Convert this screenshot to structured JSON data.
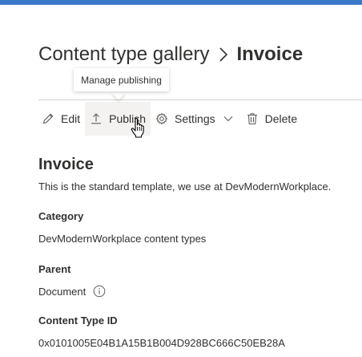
{
  "breadcrumb": {
    "parent": "Content type gallery",
    "current": "Invoice"
  },
  "tooltip": {
    "text": "Manage publishing"
  },
  "commands": {
    "edit": "Edit",
    "publish": "Publish",
    "settings": "Settings",
    "delete": "Delete"
  },
  "detail": {
    "title": "Invoice",
    "description": "This is the standard template, we use at DevModernWorkplace.",
    "category_label": "Category",
    "category_value": "DevModernWorkplace content types",
    "parent_label": "Parent",
    "parent_value": "Document",
    "id_label": "Content Type ID",
    "id_value": "0x0101005E04B1A15B1B004D928BC666C50EB28A"
  },
  "icons": {
    "edit": "pencil-icon",
    "publish": "upload-icon",
    "settings": "gear-icon",
    "settings_menu": "chevron-down-icon",
    "delete": "trash-icon",
    "breadcrumb_separator": "chevron-right-icon",
    "parent_info": "info-icon",
    "pointer": "hand-cursor-icon"
  },
  "colors": {
    "top_bar": "#3a77c7",
    "text": "#323130",
    "hover_background": "#f3f2f1",
    "icon": "#605e5c"
  }
}
